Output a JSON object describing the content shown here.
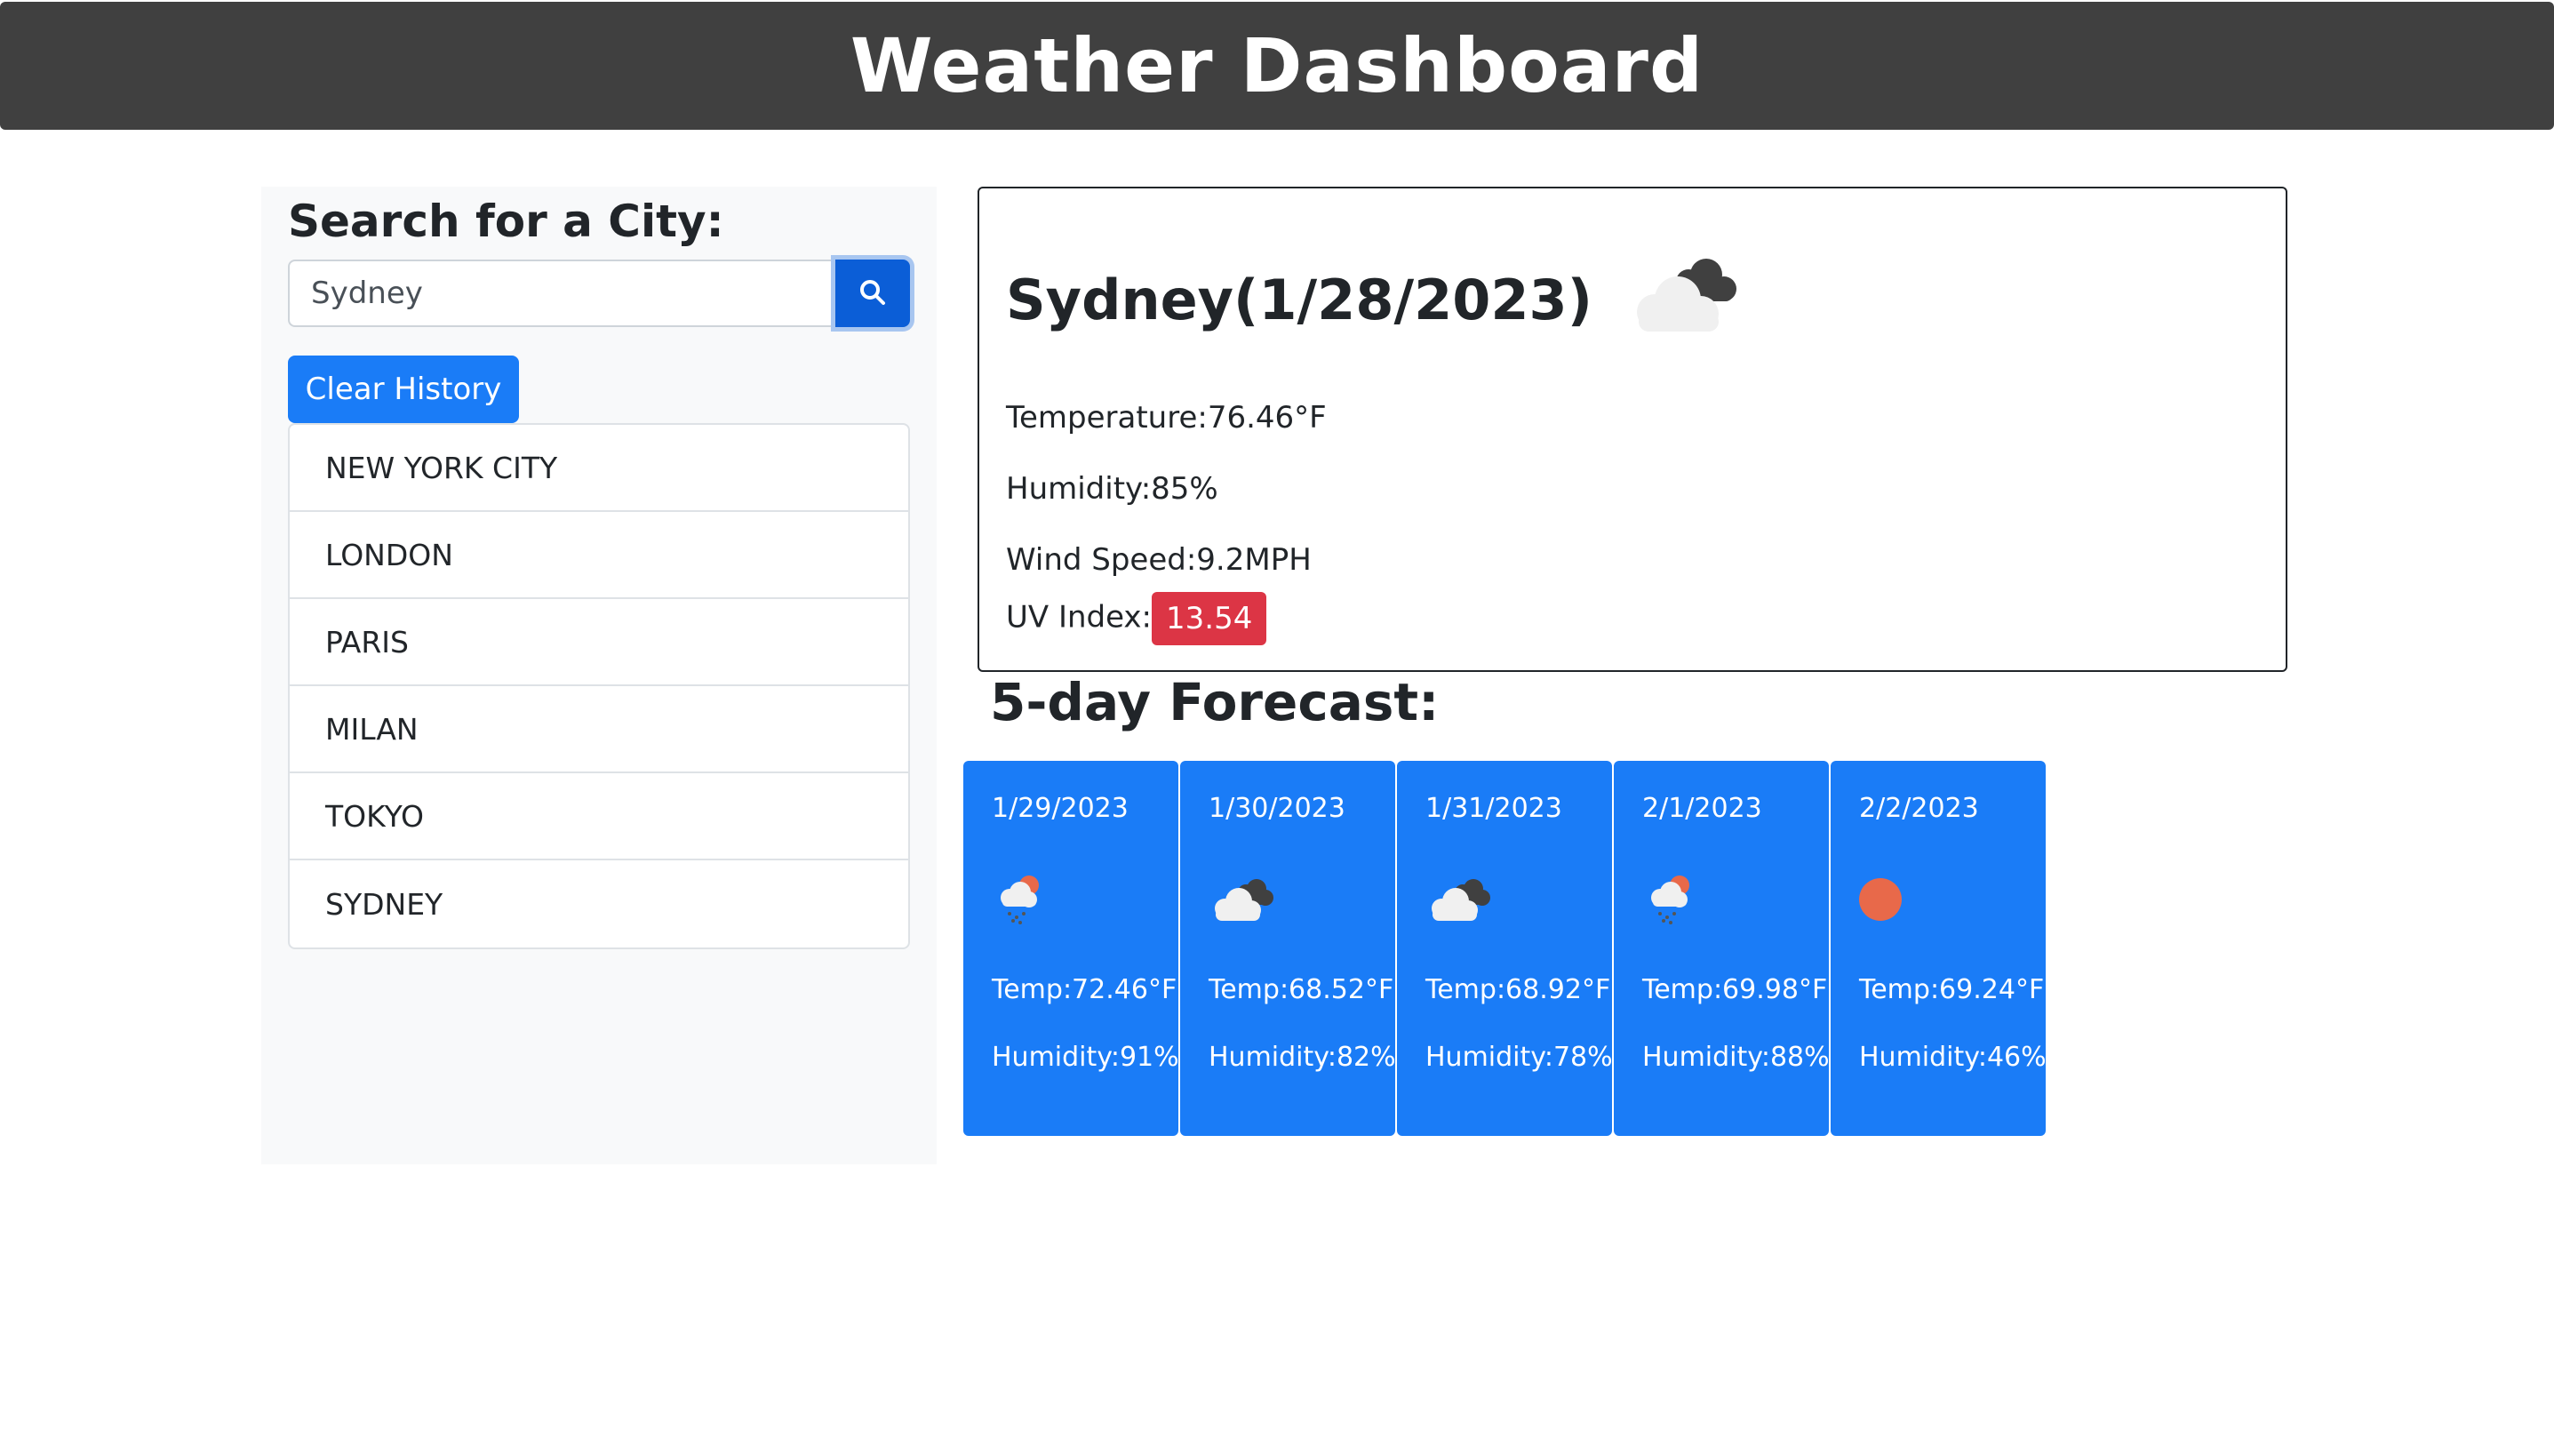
{
  "header": {
    "title": "Weather Dashboard"
  },
  "search": {
    "title": "Search for a City:",
    "value": "Sydney",
    "button_icon": "search-icon",
    "clear_label": "Clear History"
  },
  "history": [
    "NEW YORK CITY",
    "LONDON",
    "PARIS",
    "MILAN",
    "TOKYO",
    "SYDNEY"
  ],
  "current": {
    "title": "Sydney(1/28/2023)",
    "icon": "cloudy-icon",
    "temperature": "Temperature:76.46°F",
    "humidity": "Humidity:85%",
    "wind": "Wind Speed:9.2MPH",
    "uv_label": "UV Index:",
    "uv_value": "13.54",
    "uv_color": "#dc3545"
  },
  "forecast": {
    "title": "5-day Forecast:",
    "card_color": "#1a7cf7",
    "days": [
      {
        "date": "1/29/2023",
        "icon": "rain-sun-icon",
        "temp": "Temp:72.46°F",
        "humidity": "Humidity:91%"
      },
      {
        "date": "1/30/2023",
        "icon": "cloudy-icon",
        "temp": "Temp:68.52°F",
        "humidity": "Humidity:82%"
      },
      {
        "date": "1/31/2023",
        "icon": "cloudy-icon",
        "temp": "Temp:68.92°F",
        "humidity": "Humidity:78%"
      },
      {
        "date": "2/1/2023",
        "icon": "rain-sun-icon",
        "temp": "Temp:69.98°F",
        "humidity": "Humidity:88%"
      },
      {
        "date": "2/2/2023",
        "icon": "sun-icon",
        "temp": "Temp:69.24°F",
        "humidity": "Humidity:46%"
      }
    ]
  }
}
